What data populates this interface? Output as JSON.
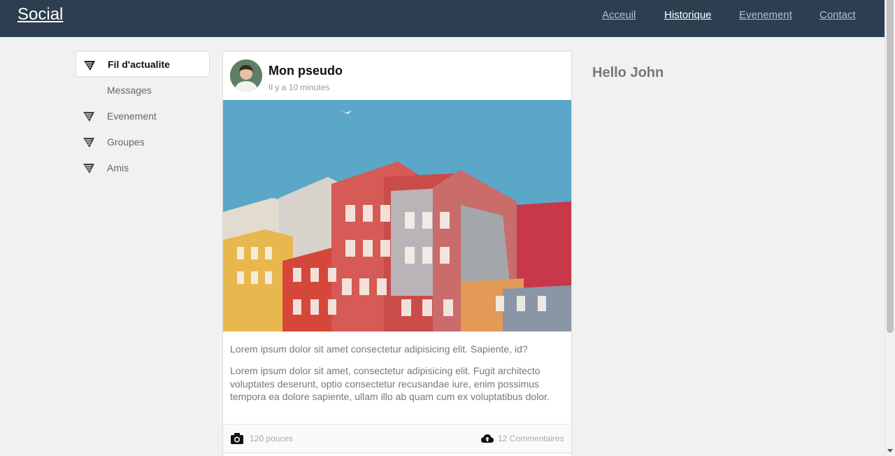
{
  "header": {
    "brand": "Social",
    "nav": [
      {
        "label": "Acceuil"
      },
      {
        "label": "Historique"
      },
      {
        "label": "Evenement"
      },
      {
        "label": "Contact"
      }
    ]
  },
  "sidebar": {
    "items": [
      {
        "label": "Fil d'actualite",
        "icon": "feed-icon"
      },
      {
        "label": "Messages",
        "icon": "messages-icon"
      },
      {
        "label": "Evenement",
        "icon": "event-icon"
      },
      {
        "label": "Groupes",
        "icon": "groups-icon"
      },
      {
        "label": "Amis",
        "icon": "friends-icon"
      }
    ]
  },
  "post": {
    "author": "Mon pseudo",
    "time": "Il y a 10 minutes",
    "paragraph_1": "Lorem ipsum dolor sit amet consectetur adipisicing elit. Sapiente, id?",
    "paragraph_2": "Lorem ipsum dolor sit amet, consectetur adipisicing elit. Fugit architecto voluptates deserunt, optio consectetur recusandae iure, enim possimus tempora ea dolore sapiente, ullam illo ab quam cum ex voluptatibus dolor.",
    "likes": "120 pouces",
    "comments": "12 Commentaires"
  },
  "right": {
    "greeting": "Hello John"
  },
  "colors": {
    "header_bg": "#2c3e50",
    "page_bg": "#f1f1f1",
    "sky": "#5aa7c8",
    "building_red": "#c83a3a"
  }
}
